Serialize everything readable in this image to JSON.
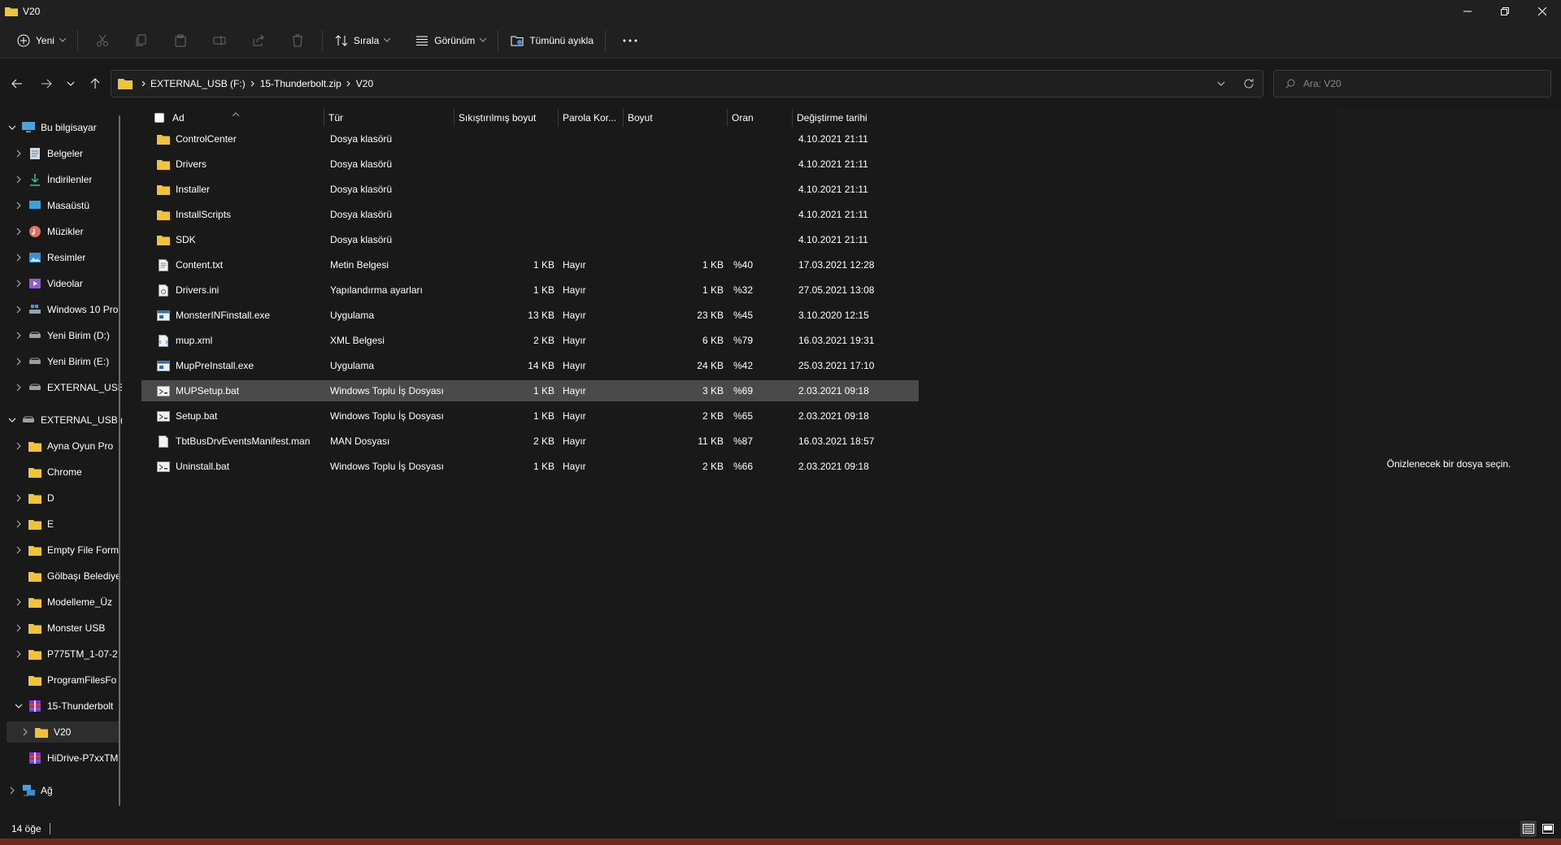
{
  "window": {
    "title": "V20"
  },
  "toolbar": {
    "new_label": "Yeni",
    "sort_label": "Sırala",
    "view_label": "Görünüm",
    "extract_all_label": "Tümünü ayıkla"
  },
  "address": {
    "crumbs": [
      "EXTERNAL_USB (F:)",
      "15-Thunderbolt.zip",
      "V20"
    ]
  },
  "search": {
    "placeholder": "Ara: V20"
  },
  "sidebar": {
    "items": [
      {
        "label": "Bu bilgisayar"
      },
      {
        "label": "Belgeler"
      },
      {
        "label": "İndirilenler"
      },
      {
        "label": "Masaüstü"
      },
      {
        "label": "Müzikler"
      },
      {
        "label": "Resimler"
      },
      {
        "label": "Videolar"
      },
      {
        "label": "Windows 10 Pro"
      },
      {
        "label": "Yeni Birim (D:)"
      },
      {
        "label": "Yeni Birim (E:)"
      },
      {
        "label": "EXTERNAL_USB"
      },
      {
        "label": "EXTERNAL_USB (F:)"
      },
      {
        "label": "Ayna Oyun Pro"
      },
      {
        "label": "Chrome"
      },
      {
        "label": "D"
      },
      {
        "label": "E"
      },
      {
        "label": "Empty File Form"
      },
      {
        "label": "Gölbaşı Belediye"
      },
      {
        "label": "Modelleme_Üz"
      },
      {
        "label": "Monster USB"
      },
      {
        "label": "P775TM_1-07-2"
      },
      {
        "label": "ProgramFilesFo"
      },
      {
        "label": "15-Thunderbolt"
      },
      {
        "label": "V20"
      },
      {
        "label": "HiDrive-P7xxTM"
      },
      {
        "label": "Ağ"
      }
    ]
  },
  "columns": {
    "name": "Ad",
    "type": "Tür",
    "compressed": "Sıkıştırılmış boyut",
    "password": "Parola Kor...",
    "size": "Boyut",
    "ratio": "Oran",
    "modified": "Değiştirme tarihi"
  },
  "files": [
    {
      "name": "ControlCenter",
      "type": "Dosya klasörü",
      "compressed": "",
      "password": "",
      "size": "",
      "ratio": "",
      "modified": "4.10.2021 21:11",
      "icon": "folder-icon"
    },
    {
      "name": "Drivers",
      "type": "Dosya klasörü",
      "compressed": "",
      "password": "",
      "size": "",
      "ratio": "",
      "modified": "4.10.2021 21:11",
      "icon": "folder-icon"
    },
    {
      "name": "Installer",
      "type": "Dosya klasörü",
      "compressed": "",
      "password": "",
      "size": "",
      "ratio": "",
      "modified": "4.10.2021 21:11",
      "icon": "folder-icon"
    },
    {
      "name": "InstallScripts",
      "type": "Dosya klasörü",
      "compressed": "",
      "password": "",
      "size": "",
      "ratio": "",
      "modified": "4.10.2021 21:11",
      "icon": "folder-icon"
    },
    {
      "name": "SDK",
      "type": "Dosya klasörü",
      "compressed": "",
      "password": "",
      "size": "",
      "ratio": "",
      "modified": "4.10.2021 21:11",
      "icon": "folder-icon"
    },
    {
      "name": "Content.txt",
      "type": "Metin Belgesi",
      "compressed": "1 KB",
      "password": "Hayır",
      "size": "1 KB",
      "ratio": "%40",
      "modified": "17.03.2021 12:28",
      "icon": "text-file-icon"
    },
    {
      "name": "Drivers.ini",
      "type": "Yapılandırma ayarları",
      "compressed": "1 KB",
      "password": "Hayır",
      "size": "1 KB",
      "ratio": "%32",
      "modified": "27.05.2021 13:08",
      "icon": "settings-file-icon"
    },
    {
      "name": "MonsterINFinstall.exe",
      "type": "Uygulama",
      "compressed": "13 KB",
      "password": "Hayır",
      "size": "23 KB",
      "ratio": "%45",
      "modified": "3.10.2020 12:15",
      "icon": "app-file-icon"
    },
    {
      "name": "mup.xml",
      "type": "XML Belgesi",
      "compressed": "2 KB",
      "password": "Hayır",
      "size": "6 KB",
      "ratio": "%79",
      "modified": "16.03.2021 19:31",
      "icon": "xml-file-icon"
    },
    {
      "name": "MupPreInstall.exe",
      "type": "Uygulama",
      "compressed": "14 KB",
      "password": "Hayır",
      "size": "24 KB",
      "ratio": "%42",
      "modified": "25.03.2021 17:10",
      "icon": "app-file-icon"
    },
    {
      "name": "MUPSetup.bat",
      "type": "Windows Toplu İş Dosyası",
      "compressed": "1 KB",
      "password": "Hayır",
      "size": "3 KB",
      "ratio": "%69",
      "modified": "2.03.2021 09:18",
      "icon": "batch-file-icon"
    },
    {
      "name": "Setup.bat",
      "type": "Windows Toplu İş Dosyası",
      "compressed": "1 KB",
      "password": "Hayır",
      "size": "2 KB",
      "ratio": "%65",
      "modified": "2.03.2021 09:18",
      "icon": "batch-file-icon"
    },
    {
      "name": "TbtBusDrvEventsManifest.man",
      "type": "MAN Dosyası",
      "compressed": "2 KB",
      "password": "Hayır",
      "size": "11 KB",
      "ratio": "%87",
      "modified": "16.03.2021 18:57",
      "icon": "blank-file-icon"
    },
    {
      "name": "Uninstall.bat",
      "type": "Windows Toplu İş Dosyası",
      "compressed": "1 KB",
      "password": "Hayır",
      "size": "2 KB",
      "ratio": "%66",
      "modified": "2.03.2021 09:18",
      "icon": "batch-file-icon"
    }
  ],
  "preview": {
    "text": "Önizlenecek bir dosya seçin."
  },
  "status": {
    "count": "14 öğe"
  },
  "colors": {
    "folder": "#f0c33c",
    "selection": "#4a4a4a",
    "background": "#191919"
  }
}
